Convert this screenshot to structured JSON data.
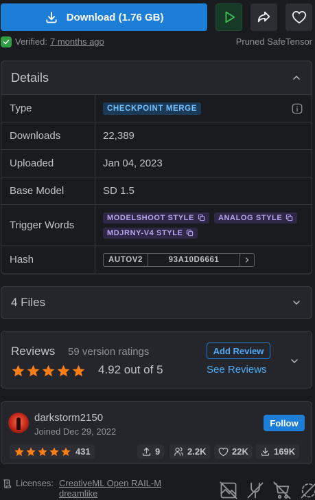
{
  "actions": {
    "download_label": "Download (1.76 GB)"
  },
  "verification": {
    "label": "Verified:",
    "time": "7 months ago",
    "file_type": "Pruned SafeTensor"
  },
  "details": {
    "title": "Details",
    "rows": {
      "type": {
        "label": "Type",
        "value": "CHECKPOINT MERGE"
      },
      "downloads": {
        "label": "Downloads",
        "value": "22,389"
      },
      "uploaded": {
        "label": "Uploaded",
        "value": "Jan 04, 2023"
      },
      "base_model": {
        "label": "Base Model",
        "value": "SD 1.5"
      },
      "trigger_words": {
        "label": "Trigger Words",
        "values": [
          "MODELSHOOT STYLE",
          "ANALOG STYLE",
          "MDJRNY-V4 STYLE"
        ]
      },
      "hash": {
        "label": "Hash",
        "algorithm": "AUTOV2",
        "value": "93A10D6661"
      }
    }
  },
  "files": {
    "title": "4 Files"
  },
  "reviews": {
    "title": "Reviews",
    "count_text": "59 version ratings",
    "score_text": "4.92 out of 5",
    "rating": 4.92,
    "add_label": "Add Review",
    "see_label": "See Reviews"
  },
  "creator": {
    "name": "darkstorm2150",
    "joined": "Joined Dec 29, 2022",
    "follow_label": "Follow",
    "rating_count": "431",
    "stats": {
      "uploads": "9",
      "followers": "2.2K",
      "favorites": "22K",
      "downloads": "169K"
    }
  },
  "license": {
    "label": "Licenses:",
    "items": [
      "CreativeML Open RAIL-M",
      "dreamlike"
    ]
  },
  "colors": {
    "primary": "#1c7ed6",
    "star": "#fd7e14",
    "verified": "#2f9e44",
    "badge_blue_text": "#74c0fc",
    "badge_purple_text": "#b8a6f0"
  },
  "icons": {
    "download": "download-icon",
    "play": "play-icon",
    "share": "share-icon",
    "favorite": "heart-icon",
    "permissions": [
      "no-images-icon",
      "no-merge-icon",
      "no-sell-icon",
      "no-generation-service-icon"
    ]
  }
}
